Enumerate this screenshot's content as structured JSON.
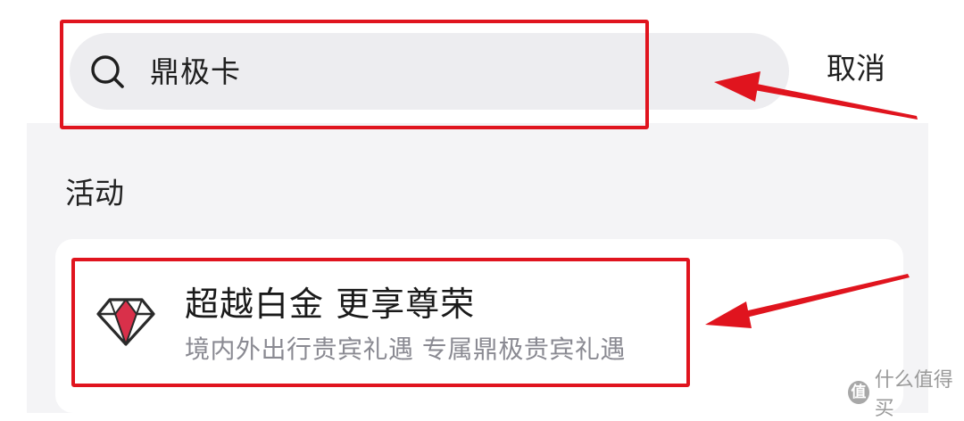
{
  "search": {
    "icon": "search-icon",
    "query": "鼎极卡",
    "cancel_label": "取消"
  },
  "section": {
    "title": "活动"
  },
  "activity_card": {
    "icon": "diamond-icon",
    "title": "超越白金 更享尊荣",
    "subtitle": "境内外出行贵宾礼遇 专属鼎极贵宾礼遇"
  },
  "annotations": {
    "highlight_color": "#e0141e"
  },
  "watermark": {
    "logo_char": "值",
    "text": "什么值得买"
  },
  "colors": {
    "search_bar_bg": "#ededf0",
    "content_bg": "#f4f4f6",
    "diamond_red": "#d9304a"
  }
}
